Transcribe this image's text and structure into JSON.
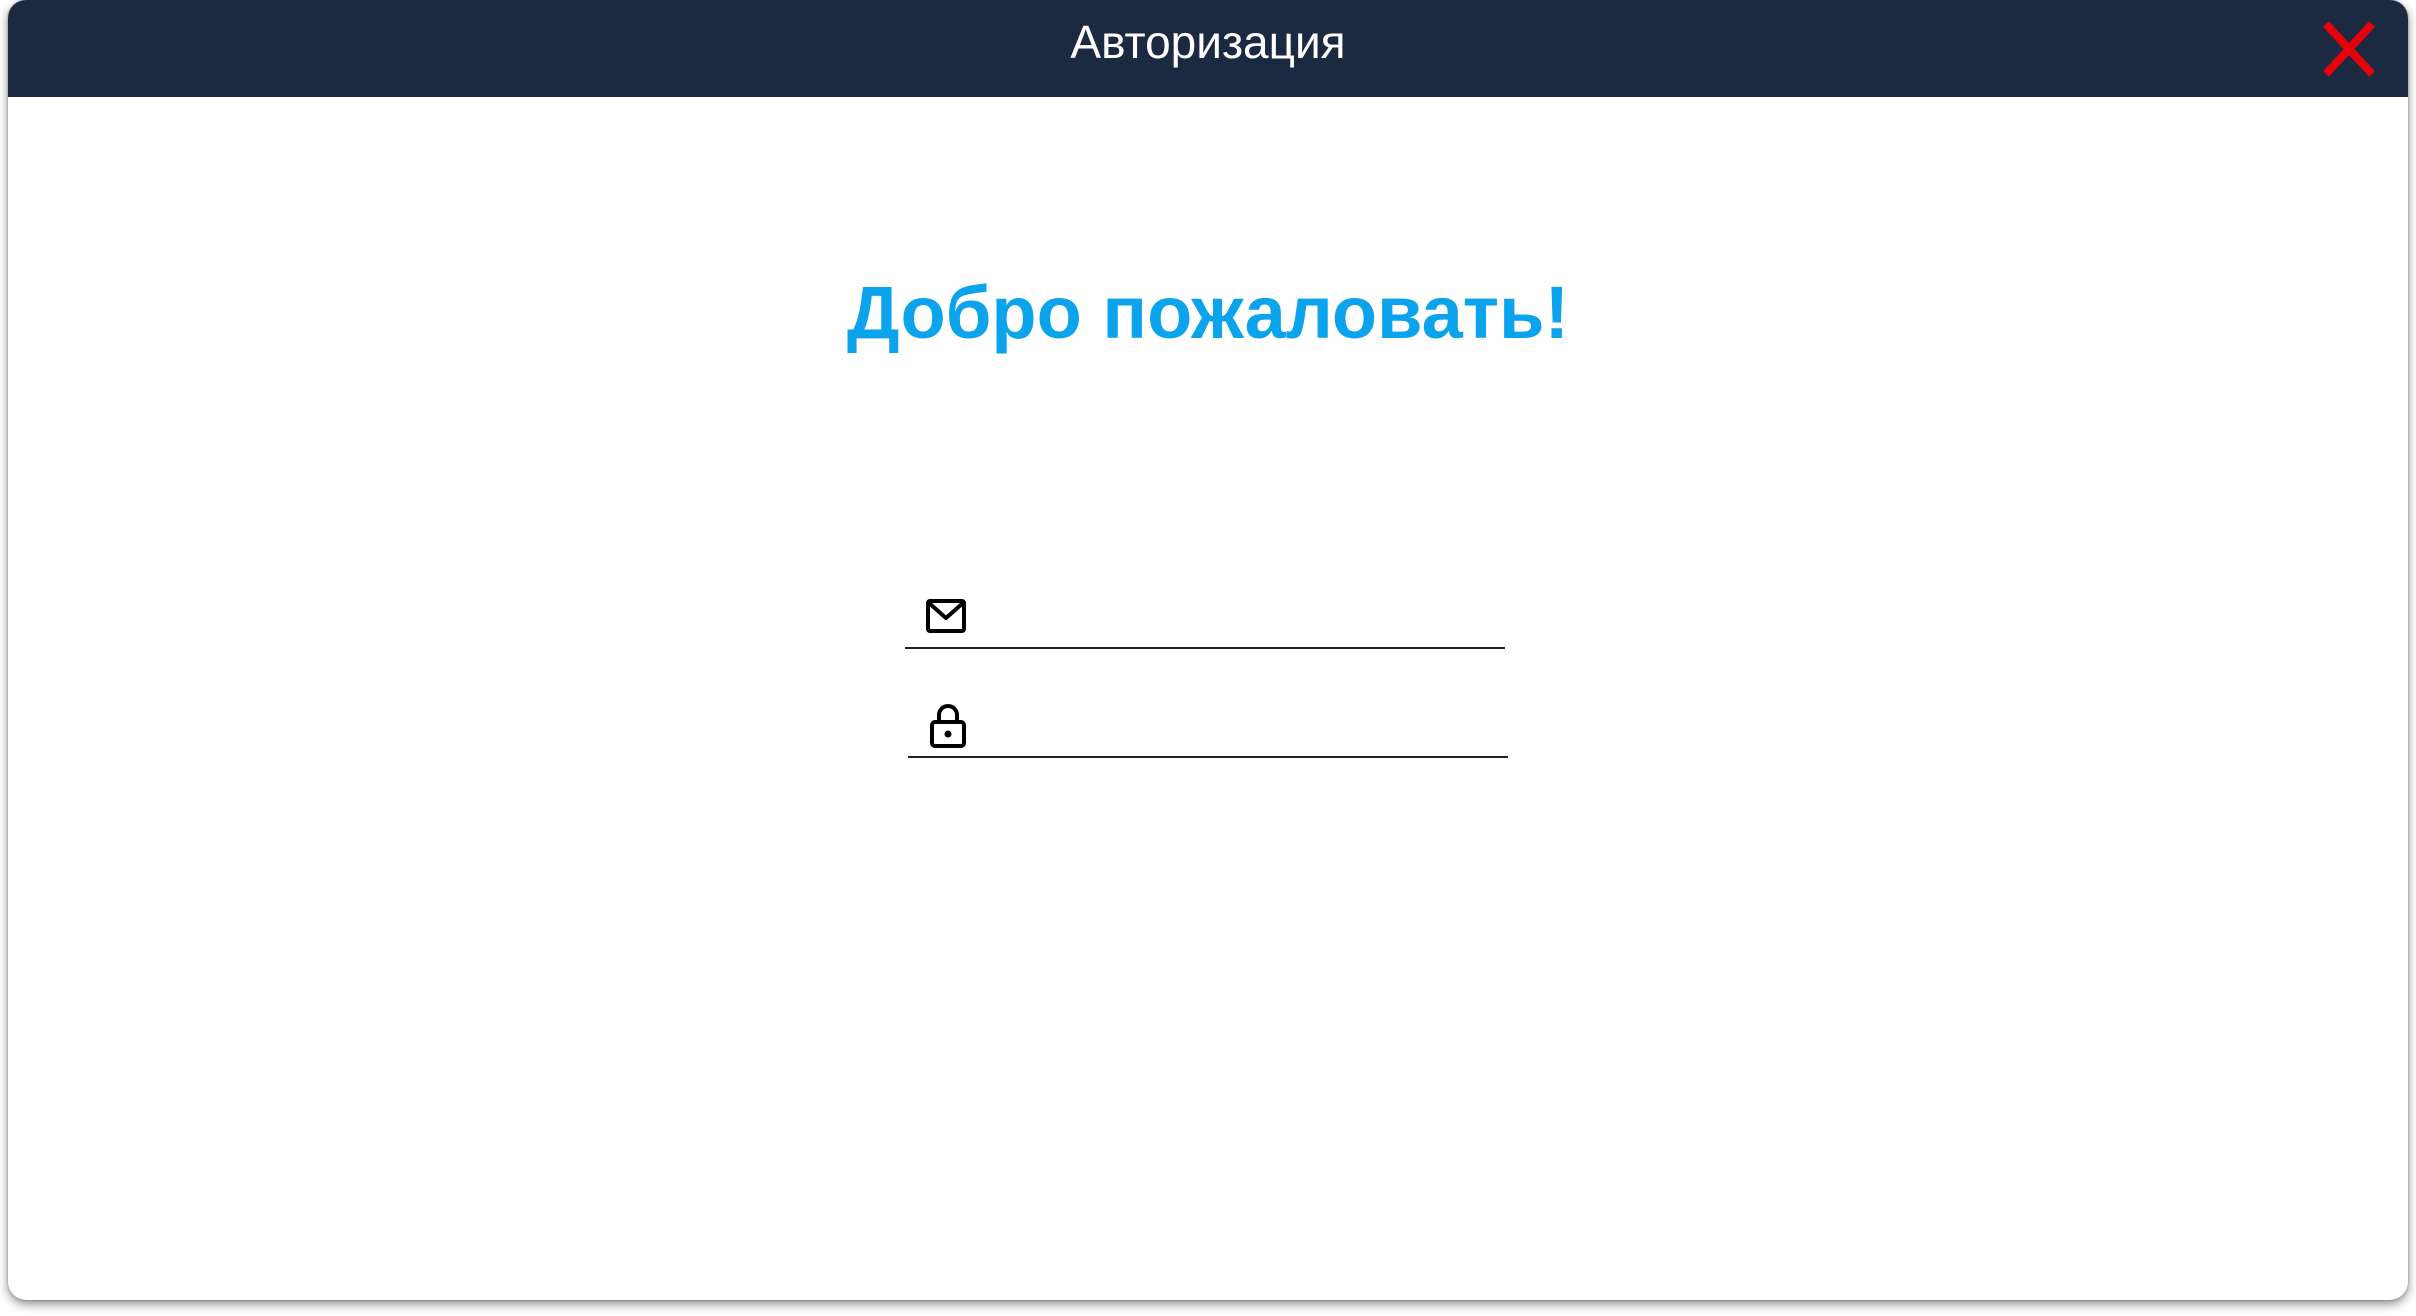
{
  "window": {
    "title": "Авторизация",
    "close_icon": "close-icon",
    "colors": {
      "titlebar": "#1b2a40",
      "close": "#e8000b",
      "accent": "#0aa3ec"
    }
  },
  "main": {
    "heading": "Добро пожаловать!"
  },
  "form": {
    "email": {
      "icon": "mail-icon",
      "value": "",
      "placeholder": ""
    },
    "password": {
      "icon": "lock-icon",
      "value": "",
      "placeholder": ""
    }
  }
}
